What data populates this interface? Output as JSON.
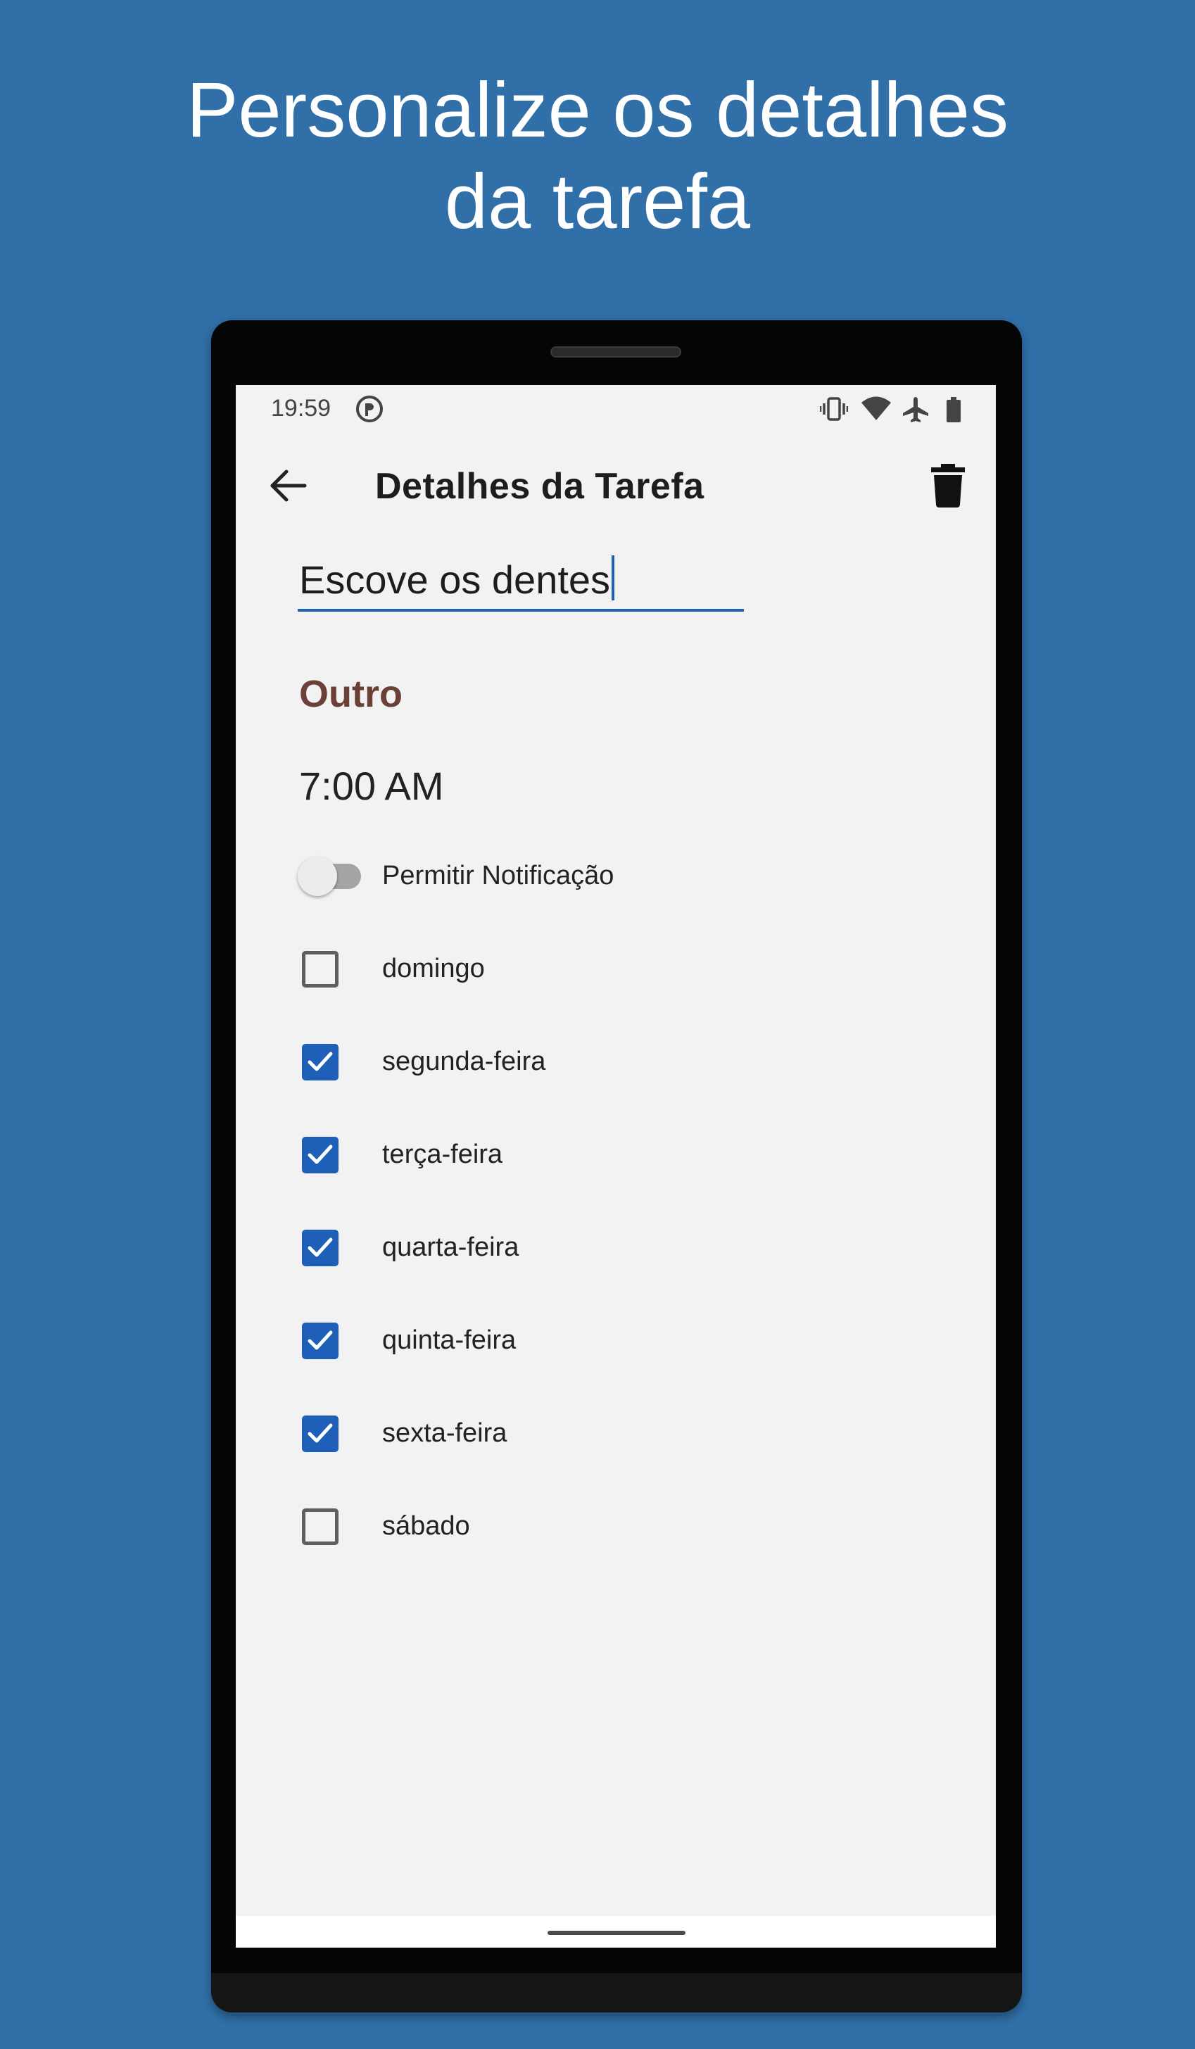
{
  "promo": {
    "line1": "Personalize os detalhes",
    "line2": "da tarefa"
  },
  "status_bar": {
    "time": "19:59",
    "icons": [
      "app-notification-icon",
      "vibrate-icon",
      "wifi-icon",
      "airplane-mode-icon",
      "battery-icon"
    ]
  },
  "app_bar": {
    "title": "Detalhes da Tarefa",
    "back_icon": "arrow-back-icon",
    "delete_icon": "trash-icon"
  },
  "task": {
    "name": "Escove os dentes",
    "category": "Outro",
    "time": "7:00 AM"
  },
  "notification": {
    "label": "Permitir Notificação",
    "enabled": false
  },
  "days": [
    {
      "label": "domingo",
      "checked": false
    },
    {
      "label": "segunda-feira",
      "checked": true
    },
    {
      "label": "terça-feira",
      "checked": true
    },
    {
      "label": "quarta-feira",
      "checked": true
    },
    {
      "label": "quinta-feira",
      "checked": true
    },
    {
      "label": "sexta-feira",
      "checked": true
    },
    {
      "label": "sábado",
      "checked": false
    }
  ],
  "colors": {
    "background": "#306fa7",
    "accent": "#1e5fb8",
    "category": "#6a4037",
    "screen": "#f2f2f2"
  }
}
